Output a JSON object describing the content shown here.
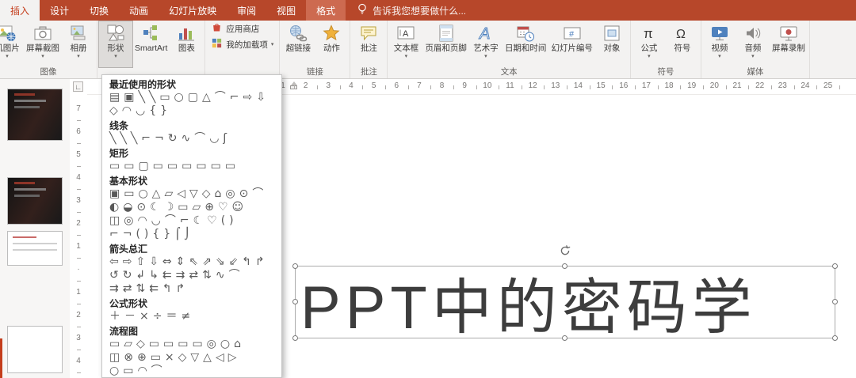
{
  "tabbar": {
    "tabs": [
      {
        "key": "insert",
        "label": "插入",
        "state": "active"
      },
      {
        "key": "design",
        "label": "设计"
      },
      {
        "key": "transitions",
        "label": "切换"
      },
      {
        "key": "animations",
        "label": "动画"
      },
      {
        "key": "slideshow",
        "label": "幻灯片放映"
      },
      {
        "key": "review",
        "label": "审阅"
      },
      {
        "key": "view",
        "label": "视图"
      },
      {
        "key": "format",
        "label": "格式",
        "state": "contextual"
      }
    ],
    "tell_me": "告诉我您想要做什么..."
  },
  "ribbon": {
    "groups": [
      {
        "key": "images",
        "label": "图像",
        "buttons": [
          {
            "key": "online-pictures",
            "label": "机图片",
            "icon": "online-picture",
            "size": "large",
            "arrow": true,
            "clipped": true
          },
          {
            "key": "screenshot",
            "label": "屏幕截图",
            "icon": "screenshot",
            "size": "large",
            "arrow": true
          },
          {
            "key": "photo-album",
            "label": "相册",
            "icon": "photo-album",
            "size": "large",
            "arrow": true
          }
        ]
      },
      {
        "key": "illustrations",
        "label": "",
        "buttons": [
          {
            "key": "shapes",
            "label": "形状",
            "icon": "shapes",
            "size": "large",
            "arrow": true,
            "pressed": true
          },
          {
            "key": "smartart",
            "label": "SmartArt",
            "icon": "smartart",
            "size": "large",
            "arrow": false
          },
          {
            "key": "chart",
            "label": "图表",
            "icon": "chart",
            "size": "large",
            "arrow": false
          }
        ]
      },
      {
        "key": "add-ins",
        "label": "",
        "buttons": [
          {
            "key": "store",
            "label": "应用商店",
            "icon": "store",
            "size": "small",
            "arrow": false
          },
          {
            "key": "my-addins",
            "label": "我的加载项",
            "icon": "my-addins",
            "size": "small",
            "arrow": true
          }
        ]
      },
      {
        "key": "links",
        "label": "链接",
        "buttons": [
          {
            "key": "hyperlink",
            "label": "超链接",
            "icon": "hyperlink",
            "size": "large",
            "arrow": false
          },
          {
            "key": "action",
            "label": "动作",
            "icon": "action",
            "size": "large",
            "arrow": false
          }
        ]
      },
      {
        "key": "comments",
        "label": "批注",
        "buttons": [
          {
            "key": "comment",
            "label": "批注",
            "icon": "comment",
            "size": "large",
            "arrow": false
          }
        ]
      },
      {
        "key": "text",
        "label": "文本",
        "buttons": [
          {
            "key": "text-box",
            "label": "文本框",
            "icon": "text-box",
            "size": "large",
            "arrow": true
          },
          {
            "key": "header-footer",
            "label": "页眉和页脚",
            "icon": "header-footer",
            "size": "large",
            "arrow": false
          },
          {
            "key": "wordart",
            "label": "艺术字",
            "icon": "wordart",
            "size": "large",
            "arrow": true
          },
          {
            "key": "date-time",
            "label": "日期和时间",
            "icon": "date-time",
            "size": "large",
            "arrow": false
          },
          {
            "key": "slide-number",
            "label": "幻灯片编号",
            "icon": "slide-number",
            "size": "large",
            "arrow": false
          },
          {
            "key": "object",
            "label": "对象",
            "icon": "object",
            "size": "large",
            "arrow": false
          }
        ]
      },
      {
        "key": "symbols",
        "label": "符号",
        "buttons": [
          {
            "key": "equation",
            "label": "公式",
            "icon": "equation",
            "size": "large",
            "arrow": true
          },
          {
            "key": "symbol",
            "label": "符号",
            "icon": "symbol",
            "size": "large",
            "arrow": false
          }
        ]
      },
      {
        "key": "media",
        "label": "媒体",
        "buttons": [
          {
            "key": "video",
            "label": "视频",
            "icon": "video",
            "size": "large",
            "arrow": true
          },
          {
            "key": "audio",
            "label": "音频",
            "icon": "audio",
            "size": "large",
            "arrow": true
          },
          {
            "key": "screen-record",
            "label": "屏幕录制",
            "icon": "screen-record",
            "size": "large",
            "arrow": false
          }
        ]
      }
    ]
  },
  "shapes_panel": {
    "sections": [
      {
        "title": "最近使用的形状",
        "rows": [
          "▤▣╲╲▭○▢△⌒⌐⇨⇩",
          "◇◠◡{}"
        ]
      },
      {
        "title": "线条",
        "rows": [
          "╲╲╲⌐¬↻∿⌒◡ʃ"
        ]
      },
      {
        "title": "矩形",
        "rows": [
          "▭▭▢▭▭▭▭▭▭"
        ]
      },
      {
        "title": "基本形状",
        "rows": [
          "▣▭○△▱◁▽◇⌂◎⊙⌒",
          "◐◒⊙☾☽▭▱⊕♡☺",
          "◫◎◠◡⌒⌐☾♡()",
          "⌐¬(){}⌠⌡"
        ]
      },
      {
        "title": "箭头总汇",
        "rows": [
          "⇦⇨⇧⇩⇔⇕⇖⇗⇘⇙↰↱",
          "↺↻↲↳⇇⇉⇄⇅∿⌒",
          "⇉⇄⇅⇇↰↱"
        ]
      },
      {
        "title": "公式形状",
        "rows": [
          "＋－×÷＝≠"
        ]
      },
      {
        "title": "流程图",
        "rows": [
          "▭▱◇▭▭▭▭◎○⌂",
          "◫⊗⊕▭×◇▽△◁▷",
          "○▭◠⌒"
        ]
      }
    ]
  },
  "rulers": {
    "horizontal": [
      "1",
      "2",
      "3",
      "4",
      "5",
      "6",
      "7",
      "8",
      "9",
      "10",
      "11",
      "12",
      "13",
      "14",
      "15",
      "16",
      "17",
      "18",
      "19",
      "20",
      "21",
      "22",
      "23",
      "24",
      "25"
    ],
    "vertical": [
      "7",
      "6",
      "5",
      "4",
      "3",
      "2",
      "1",
      "·",
      "1",
      "2",
      "3",
      "4"
    ]
  },
  "slide": {
    "text": "PPT中的密码学"
  },
  "thumbnails": [
    {
      "variant": "dark"
    },
    {
      "variant": "dark"
    },
    {
      "variant": "text"
    },
    {
      "variant": "plain"
    }
  ]
}
